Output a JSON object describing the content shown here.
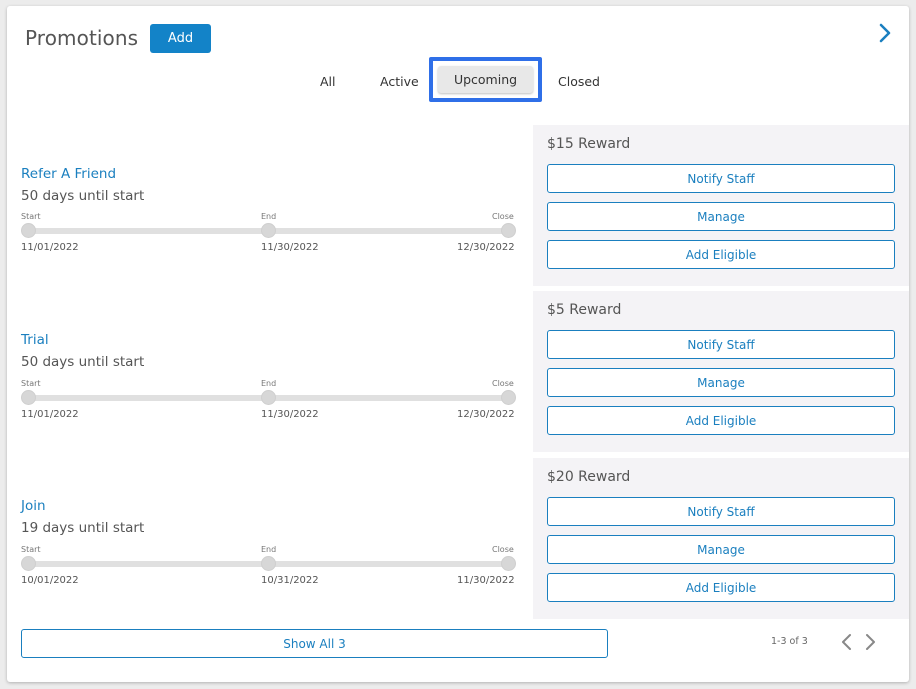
{
  "header": {
    "title": "Promotions",
    "add_label": "Add"
  },
  "filters": {
    "all": "All",
    "active": "Active",
    "upcoming": "Upcoming",
    "closed": "Closed",
    "selected": "Upcoming"
  },
  "timeline_labels": {
    "start": "Start",
    "end": "End",
    "close": "Close"
  },
  "actions": {
    "notify": "Notify Staff",
    "manage": "Manage",
    "add_eligible": "Add Eligible"
  },
  "promotions": [
    {
      "name": "Refer A Friend",
      "days": "50 days until start",
      "start": "11/01/2022",
      "end": "11/30/2022",
      "close": "12/30/2022",
      "reward": "$15 Reward"
    },
    {
      "name": "Trial",
      "days": "50 days until start",
      "start": "11/01/2022",
      "end": "11/30/2022",
      "close": "12/30/2022",
      "reward": "$5 Reward"
    },
    {
      "name": "Join",
      "days": "19 days until start",
      "start": "10/01/2022",
      "end": "10/31/2022",
      "close": "11/30/2022",
      "reward": "$20 Reward"
    }
  ],
  "footer": {
    "show_all": "Show All 3",
    "page_info": "1-3 of 3"
  },
  "colors": {
    "accent": "#1383c8",
    "link": "#1a7fbf",
    "highlight": "#2f6fe8",
    "reward_bg": "#f4f3f6"
  }
}
